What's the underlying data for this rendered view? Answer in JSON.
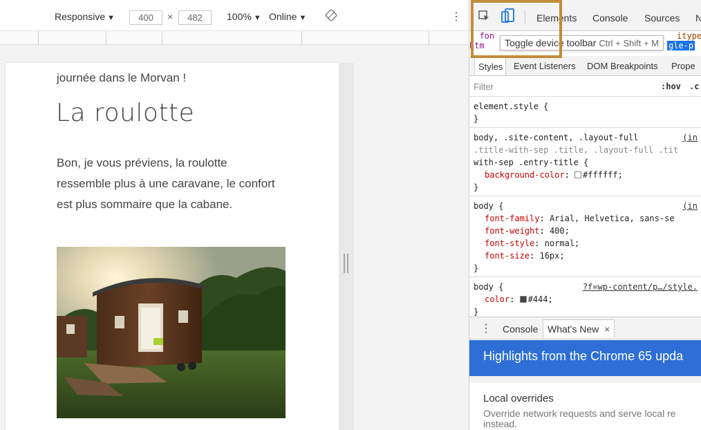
{
  "device_toolbar": {
    "mode_label": "Responsive",
    "width_value": "400",
    "times_sign": "×",
    "height_value": "482",
    "zoom_label": "100%",
    "network_label": "Online",
    "dropdown_glyph": "▼",
    "more_glyph": "⋮"
  },
  "page": {
    "fragment": "journée dans le Morvan !",
    "heading": "La roulotte",
    "paragraph": "Bon, je vous préviens, la roulotte ressemble plus à une caravane, le confort est plus sommaire que la cabane."
  },
  "devtools": {
    "tabs": [
      "Elements",
      "Console",
      "Sources",
      "N"
    ],
    "elements_lines": [
      "  fon",
      "htm"
    ],
    "elements_right": [
      "itype",
      "gle-p"
    ],
    "tooltip_text": "Toggle device toolbar",
    "tooltip_shortcut": "Ctrl + Shift + M",
    "subtabs": [
      "Styles",
      "Event Listeners",
      "DOM Breakpoints",
      "Prope"
    ],
    "filter_placeholder": "Filter",
    "hov_label": ":hov",
    "cls_label": ".c",
    "rules": {
      "r1_selector": "element.style {",
      "r2_selector_l1": "body, .site-content, .layout-full",
      "r2_selector_l2": ".title-with-sep .title, .layout-full .tit",
      "r2_selector_l3": "with-sep .entry-title {",
      "r2_source": "(in",
      "r2_prop1": "background-color",
      "r2_val1": "#ffffff;",
      "r3_selector": "body {",
      "r3_source": "(in",
      "r3_prop1": "font-family",
      "r3_val1": "Arial, Helvetica, sans-se",
      "r3_prop2": "font-weight",
      "r3_val2": "400;",
      "r3_prop3": "font-style",
      "r3_val3": "normal;",
      "r3_prop4": "font-size",
      "r3_val4": "16px;",
      "r4_selector": "body {",
      "r4_source": "?f=wp-content/p…/style.",
      "r4_prop1": "color",
      "r4_val1": "#444;",
      "close_brace": "}",
      "colon": ": "
    },
    "drawer": {
      "tab_console": "Console",
      "tab_whats_new": "What's New",
      "close_glyph": "×",
      "banner": "Highlights from the Chrome 65 upda",
      "item_title": "Local overrides",
      "item_desc_1": "Override network requests and serve local re",
      "item_desc_2": "instead."
    }
  },
  "colors": {
    "highlight_box": "#c08d3a",
    "banner": "#2d6fd6",
    "css_property": "#c80000",
    "swatch_white": "#ffffff",
    "swatch_text": "#444444"
  }
}
